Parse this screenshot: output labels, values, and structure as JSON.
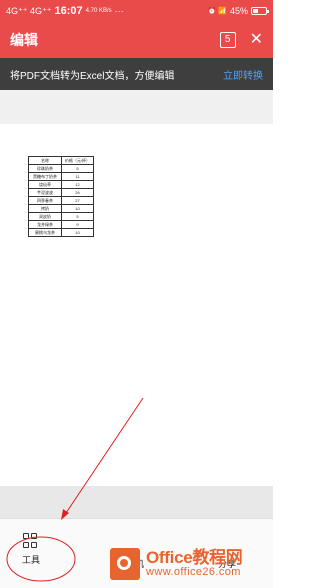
{
  "status_bar": {
    "network_left": "4G⁺⁺ 4G⁺⁺",
    "time": "16:07",
    "speed": "4.70 KB/s",
    "dots": "···",
    "icons_right": "⏰ 📶",
    "battery_percent": "45%",
    "battery_level": 0.45
  },
  "app_bar": {
    "title": "编辑",
    "page_count": "5",
    "close_glyph": "✕"
  },
  "banner": {
    "text": "将PDF文档转为Excel文档，方便编辑",
    "action": "立即转换"
  },
  "sheet": {
    "headers": [
      "名称",
      "价格（元/杯）"
    ],
    "rows": [
      [
        "珍珠奶茶",
        "5"
      ],
      [
        "黑糖布丁奶茶",
        "11"
      ],
      [
        "烧仙草",
        "12"
      ],
      [
        "芋泥波波",
        "26"
      ],
      [
        "四季春茶",
        "27"
      ],
      [
        "拷奶",
        "10"
      ],
      [
        "双皮奶",
        "5"
      ],
      [
        "龙井绿茶",
        "9"
      ],
      [
        "蜜桃乌龙茶",
        "10"
      ]
    ]
  },
  "toolbar": {
    "tools_label": "工具",
    "phone_label": "手机",
    "share_label": "分享"
  },
  "watermark": {
    "line1": "Office教程网",
    "line2": "www.office26.com"
  },
  "annotation_color": "#e02020"
}
